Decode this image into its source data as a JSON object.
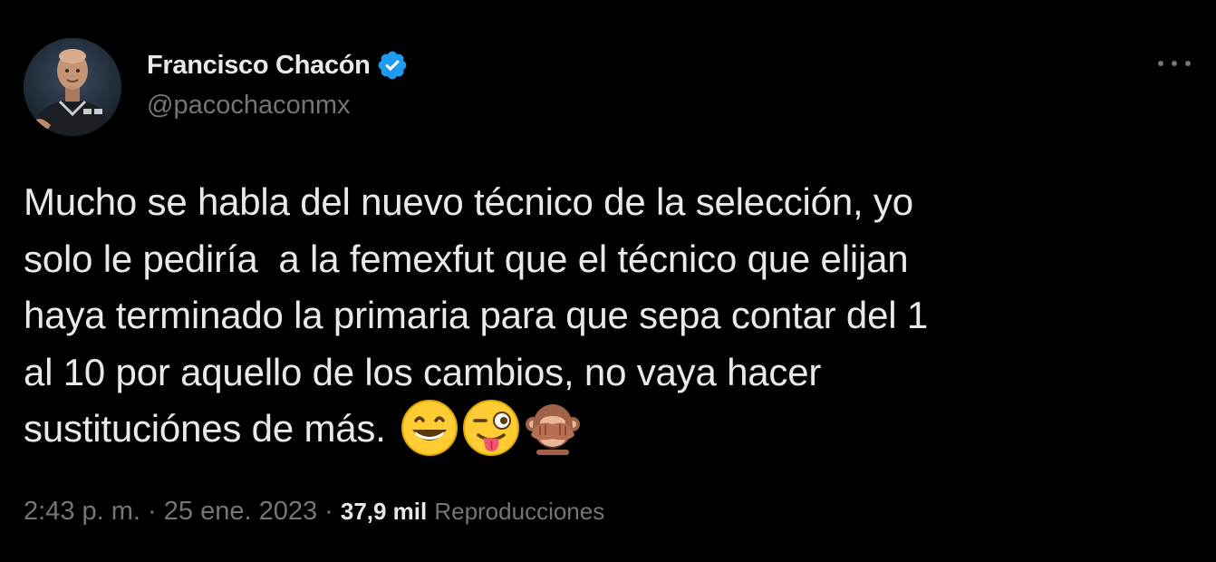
{
  "author": {
    "name": "Francisco Chacón",
    "handle": "@pacochaconmx",
    "verified": true
  },
  "icons": {
    "avatar": "avatar",
    "verified": "verified-badge-icon",
    "more": "more-dots-icon",
    "emoji_1": "grinning-face-emoji",
    "emoji_2": "winking-face-tongue-emoji",
    "emoji_3": "see-no-evil-monkey-emoji"
  },
  "tweet": {
    "lines": [
      "Mucho se habla del nuevo técnico de la selección, yo",
      "solo le pediría  a la femexfut que el técnico que elijan",
      "haya terminado la primaria para que sepa contar del 1",
      "al 10 por aquello de los cambios, no vaya hacer",
      "sustituciónes de más."
    ]
  },
  "meta": {
    "time": "2:43 p. m.",
    "separator": " · ",
    "date": "25 ene. 2023",
    "views_count": "37,9 mil",
    "views_label": "Reproducciones"
  },
  "colors": {
    "background": "#000000",
    "text": "#e7e9ea",
    "secondary": "#71767b",
    "verified": "#1d9bf0"
  }
}
